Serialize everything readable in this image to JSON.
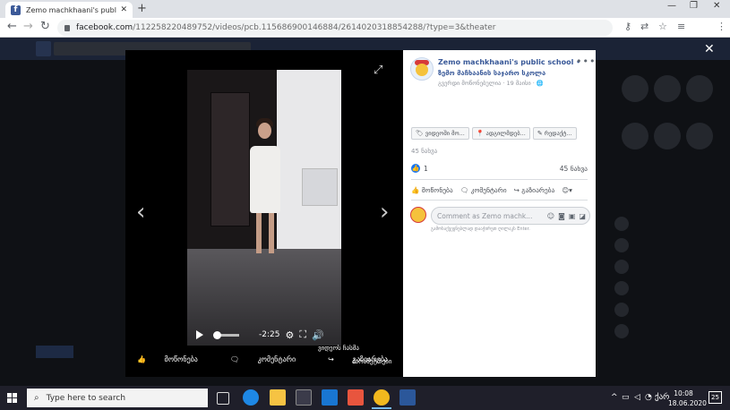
{
  "browser": {
    "tab_title": "Zemo machkhaani's public school",
    "url_host": "facebook.com",
    "url_path": "/112258220489752/videos/pcb.115686900146884/2614020318854288/?type=3&theater",
    "min_icon": "minimize-icon",
    "max_icon": "maximize-icon",
    "close_icon": "close-icon"
  },
  "theater": {
    "video_time": "-2:25",
    "embed_link": "ვიდეოს ჩასმა",
    "like": "მოწონება",
    "comment": "კომენტარი",
    "share": "გაზიარება",
    "options": "პარამეტრები"
  },
  "post": {
    "page_name": "Zemo machkhaani's public school •",
    "page_name_ka": "ზემო მაჩხაანის საჯარო სკოლა",
    "meta": "გვერდი მოწონებულია · 19 მაისი ·",
    "chips": [
      {
        "icon": "tag-icon",
        "label": "ვიდეოში მო..."
      },
      {
        "icon": "location-icon",
        "label": "ადგილმდებ..."
      },
      {
        "icon": "edit-icon",
        "label": "რედაქტ..."
      }
    ],
    "views_label": "45 ნახვა",
    "likes_count": "1",
    "views_right": "45 ნახვა",
    "like": "მოწონება",
    "comment": "კომენტარი",
    "share": "გაზიარება",
    "comment_placeholder": "Comment as Zemo machk...",
    "comment_hint": "გამოსაქვეყნებლად დააჭირეთ ღილაკს Enter."
  },
  "taskbar": {
    "search_placeholder": "Type here to search",
    "time": "10:08",
    "date": "18.06.2020",
    "lang": "ქარ",
    "notifications": "25",
    "mail_badge": "19"
  },
  "colors": {
    "fb_blue": "#385898",
    "like_blue": "#1877f2",
    "taskbar": "#1f1f2a"
  }
}
